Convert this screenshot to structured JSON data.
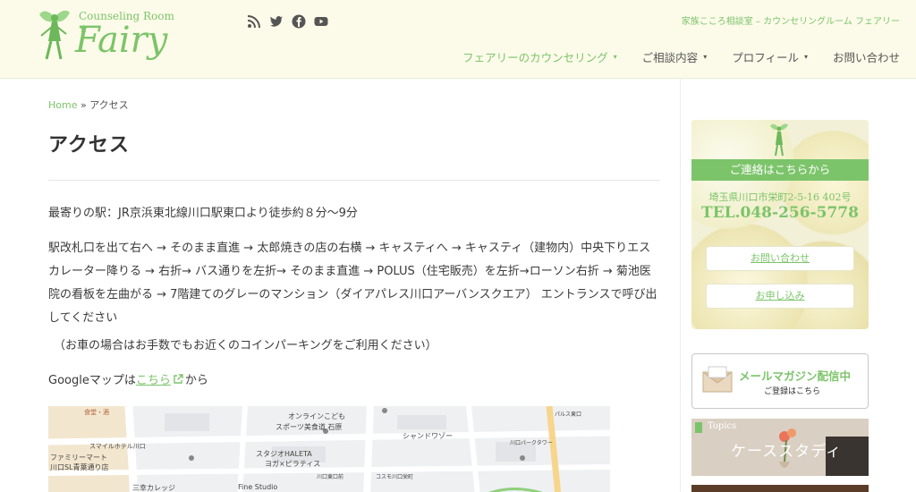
{
  "header": {
    "logo_small": "Counseling Room ★",
    "logo_big": "Fairy",
    "tagline": "家族こころ相談室 – カウンセリングルーム フェアリー",
    "social_icons": [
      "rss-icon",
      "twitter-icon",
      "facebook-icon",
      "youtube-icon"
    ],
    "nav": [
      {
        "label": "フェアリーのカウンセリング",
        "caret": "▾"
      },
      {
        "label": "ご相談内容",
        "caret": "▾"
      },
      {
        "label": "プロフィール",
        "caret": "▾"
      },
      {
        "label": "お問い合わせ",
        "caret": ""
      }
    ]
  },
  "breadcrumb": {
    "home": "Home",
    "separator": "»",
    "current": "アクセス"
  },
  "page_title": "アクセス",
  "content": {
    "nearest_station": "最寄りの駅：JR京浜東北線川口駅東口より徒歩約８分〜9分",
    "directions": "駅改札口を出て右へ → そのまま直進 → 太郎焼きの店の右横 → キャスティへ → キャスティ（建物内）中央下りエスカレーター降りる → 右折→ バス通りを左折→ そのまま直進 → POLUS（住宅販売）を左折→ローソン右折 → 菊池医院の看板を左曲がる → 7階建てのグレーのマンション（ダイアパレス川口アーバンスクエア） エントランスで呼び出してください",
    "car_note": "（お車の場合はお手数でもお近くのコインパーキングをご利用ください）",
    "map_prefix": "Googleマップは",
    "map_link": "こちら",
    "map_suffix": "から"
  },
  "map": {
    "labels": [
      "食堂・酒",
      "オンラインこども",
      "スポーツ美食道 石原",
      "シャンドワゾー",
      "スマイルホテル川口",
      "ファミリーマート",
      "川口SL青葉通り店",
      "スタジオHALETA",
      "ヨガ×ピラティス",
      "三幸カレッジ",
      "Fine Studio",
      "川口パークタワー",
      "パルス東口",
      "川口東口前",
      "コスモ川口栄町"
    ]
  },
  "sidebar": {
    "contact_title": "ご連絡はこちらから",
    "contact_address": "埼玉県川口市栄町2-5-16 402号",
    "contact_tel": "TEL.048-256-5778",
    "contact_buttons": [
      "お問い合わせ",
      "お申し込み"
    ],
    "mail_title": "メールマガジン配信中",
    "mail_sub": "ご登録はこちら",
    "topics_label": "Topics",
    "topics_title": "ケーススタディ"
  }
}
